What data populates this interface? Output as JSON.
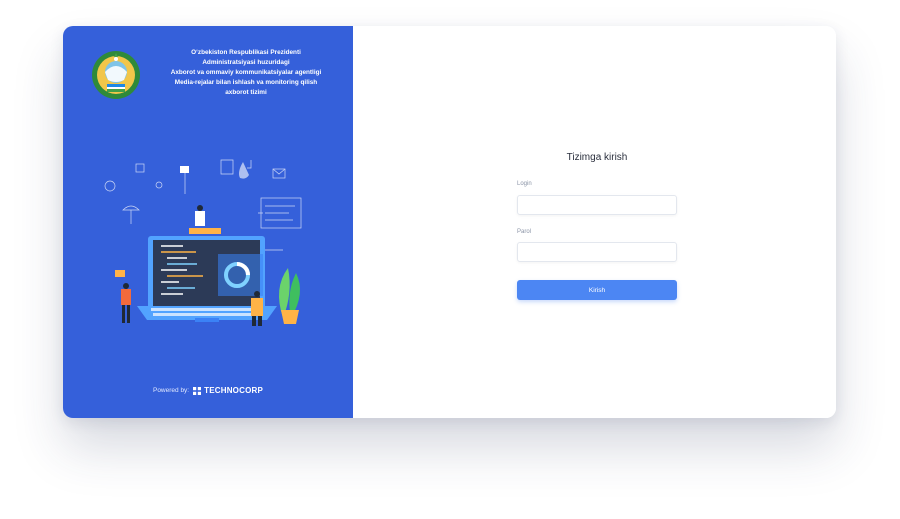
{
  "org": {
    "title_lines": [
      "O‘zbekiston Respublikasi Prezidenti",
      "Administratsiyasi huzuridagi",
      "Axborot va ommaviy kommunikatsiyalar agentligi",
      "Media-rejalar bilan ishlash va monitoring qilish",
      "axborot tizimi"
    ]
  },
  "footer": {
    "powered_label": "Powered by:",
    "brand": "TECHNOCORP"
  },
  "login": {
    "title": "Tizimga kirish",
    "login_label": "Login",
    "login_value": "",
    "password_label": "Parol",
    "password_value": "",
    "submit_label": "Kirish"
  },
  "colors": {
    "sidebar_bg": "#3560da",
    "button_bg": "#4c86f3"
  },
  "icons": [
    "state-emblem-icon",
    "technocorp-logo-icon"
  ]
}
